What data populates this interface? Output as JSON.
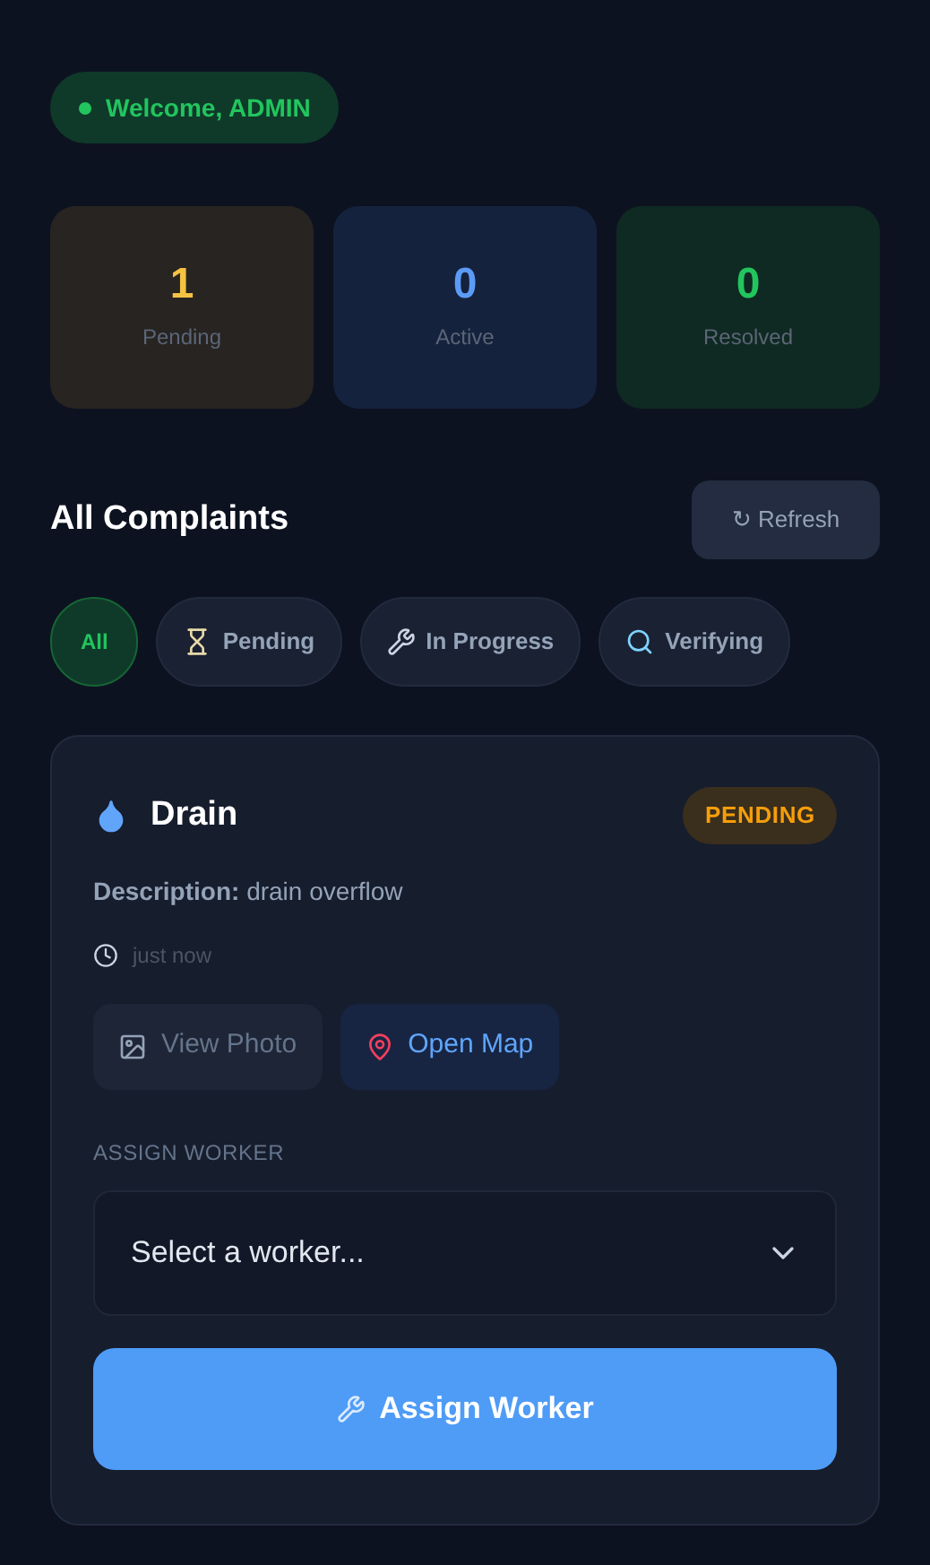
{
  "welcome": {
    "text": "Welcome, ADMIN"
  },
  "stats": [
    {
      "kind": "pending",
      "value": "1",
      "label": "Pending"
    },
    {
      "kind": "active",
      "value": "0",
      "label": "Active"
    },
    {
      "kind": "resolved",
      "value": "0",
      "label": "Resolved"
    }
  ],
  "heading": "All Complaints",
  "refresh_button": "↻ Refresh",
  "filters": [
    {
      "label": "All",
      "kind": "all",
      "selected": true
    },
    {
      "label": "Pending",
      "kind": "pending",
      "selected": false
    },
    {
      "label": "In Progress",
      "kind": "progress",
      "selected": false
    },
    {
      "label": "Verifying",
      "kind": "verifying",
      "selected": false
    }
  ],
  "complaint": {
    "title": "Drain",
    "status": "PENDING",
    "description": "**Description:** drain overflow",
    "time": "just now",
    "actions": [
      {
        "kind": "photo",
        "label": "View Photo"
      },
      {
        "kind": "map",
        "label": "Open Map"
      }
    ],
    "assign_label": "ASSIGN WORKER",
    "worker_select": {
      "placeholder": "Select a worker..."
    },
    "assign_button": "Assign Worker"
  }
}
